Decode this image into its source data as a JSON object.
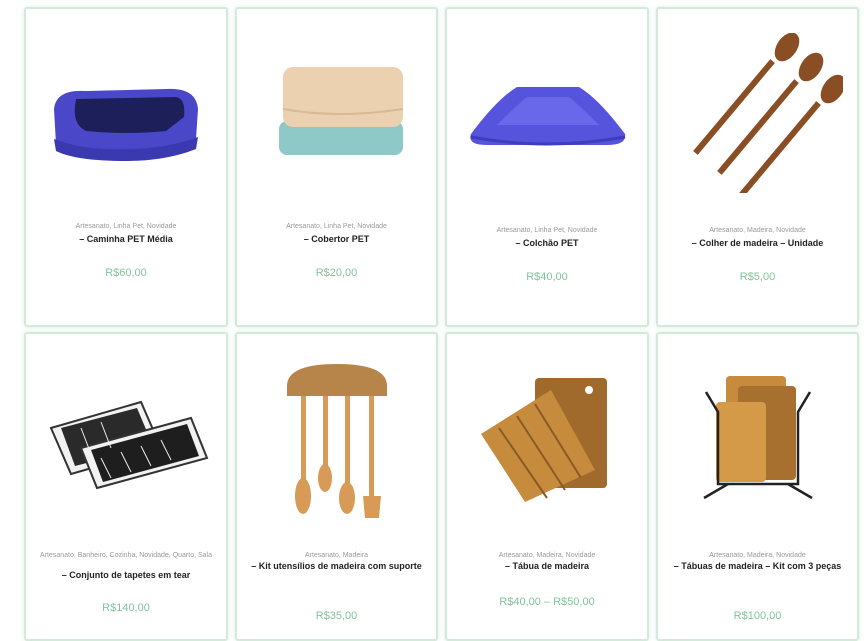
{
  "currency_note": "",
  "products": [
    {
      "icon": "pet-bed-icon",
      "categories": "Artesanato, Linha Pet, Novidade",
      "title": "– Caminha PET Média",
      "price": "R$60,00"
    },
    {
      "icon": "pet-blanket-icon",
      "categories": "Artesanato, Linha Pet, Novidade",
      "title": "– Cobertor PET",
      "price": "R$20,00"
    },
    {
      "icon": "pet-mattress-icon",
      "categories": "Artesanato, Linha Pet, Novidade",
      "title": "– Colchão PET",
      "price": "R$40,00"
    },
    {
      "icon": "wooden-spoons-icon",
      "categories": "Artesanato, Madeira, Novidade",
      "title": "– Colher de madeira – Unidade",
      "price": "R$5,00"
    },
    {
      "icon": "rugs-icon",
      "categories": "Artesanato, Banheiro, Cozinha, Novidade, Quarto, Sala",
      "title": "– Conjunto de tapetes em tear",
      "price": "R$140,00"
    },
    {
      "icon": "utensil-rack-icon",
      "categories": "Artesanato, Madeira",
      "title": "– Kit utensílios de madeira com suporte",
      "price": "R$35,00"
    },
    {
      "icon": "cutting-boards-icon",
      "categories": "Artesanato, Madeira, Novidade",
      "title": "– Tábua de madeira",
      "price": "R$40,00 – R$50,00"
    },
    {
      "icon": "board-rack-icon",
      "categories": "Artesanato, Madeira, Novidade",
      "title": "– Tábuas de madeira – Kit com 3 peças",
      "price": "R$100,00"
    }
  ]
}
